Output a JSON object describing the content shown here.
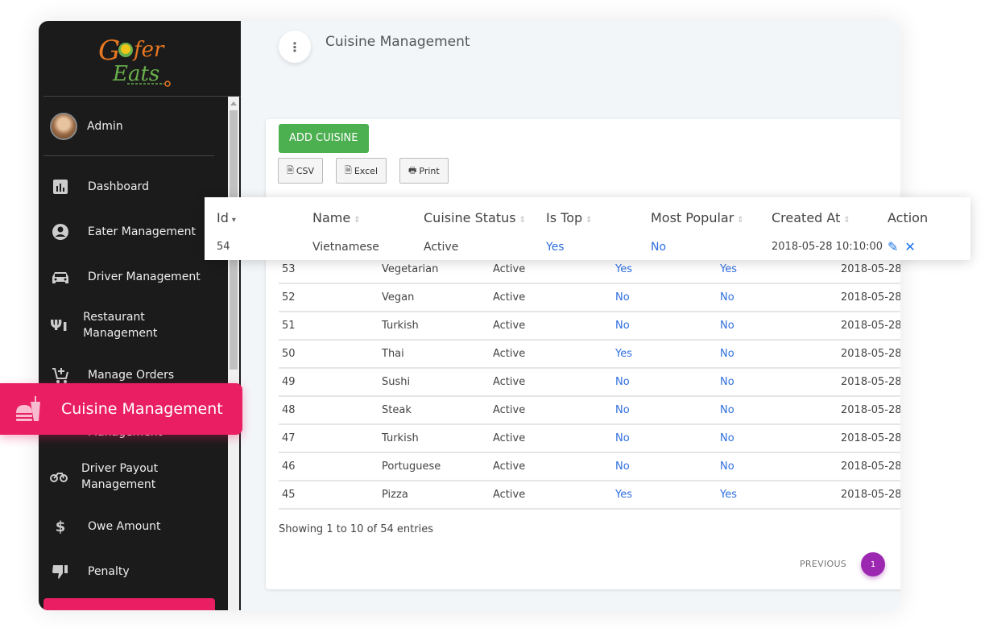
{
  "app": {
    "brand": "Gofer Eats"
  },
  "sidebar": {
    "user": {
      "name": "Admin"
    },
    "items": [
      {
        "label": "Dashboard",
        "icon": "bar-chart-icon"
      },
      {
        "label": "Eater Management",
        "icon": "account-circle-icon"
      },
      {
        "label": "Driver Management",
        "icon": "car-icon"
      },
      {
        "label": "Restaurant Management",
        "icon": "restaurant-icon"
      },
      {
        "label": "Manage Orders",
        "icon": "cart-plus-icon"
      },
      {
        "label": "Management",
        "icon": "payout-icon"
      },
      {
        "label": "Driver Payout Management",
        "icon": "motorcycle-icon"
      },
      {
        "label": "Owe Amount",
        "icon": "dollar-icon"
      },
      {
        "label": "Penalty",
        "icon": "thumbs-down-icon"
      }
    ],
    "active_item": {
      "label": "Cuisine Management",
      "icon": "fastfood-icon"
    }
  },
  "header": {
    "title": "Cuisine Management",
    "menu_icon": "more-vert-icon"
  },
  "toolbar": {
    "add_label": "ADD CUISINE",
    "csv_label": "CSV",
    "excel_label": "Excel",
    "print_label": "Print"
  },
  "table": {
    "columns": [
      "Id",
      "Name",
      "Cuisine Status",
      "Is Top",
      "Most Popular",
      "Created At",
      "Action"
    ],
    "highlight_row": {
      "id": "54",
      "name": "Vietnamese",
      "status": "Active",
      "is_top": "Yes",
      "most_popular": "No",
      "created_at": "2018-05-28 10:10:00"
    },
    "rows": [
      {
        "id": "53",
        "name": "Vegetarian",
        "status": "Active",
        "is_top": "Yes",
        "most_popular": "Yes",
        "created_at": "2018-05-28"
      },
      {
        "id": "52",
        "name": "Vegan",
        "status": "Active",
        "is_top": "No",
        "most_popular": "No",
        "created_at": "2018-05-28"
      },
      {
        "id": "51",
        "name": "Turkish",
        "status": "Active",
        "is_top": "No",
        "most_popular": "No",
        "created_at": "2018-05-28"
      },
      {
        "id": "50",
        "name": "Thai",
        "status": "Active",
        "is_top": "Yes",
        "most_popular": "No",
        "created_at": "2018-05-28"
      },
      {
        "id": "49",
        "name": "Sushi",
        "status": "Active",
        "is_top": "No",
        "most_popular": "No",
        "created_at": "2018-05-28"
      },
      {
        "id": "48",
        "name": "Steak",
        "status": "Active",
        "is_top": "No",
        "most_popular": "No",
        "created_at": "2018-05-28"
      },
      {
        "id": "47",
        "name": "Turkish",
        "status": "Active",
        "is_top": "No",
        "most_popular": "No",
        "created_at": "2018-05-28"
      },
      {
        "id": "46",
        "name": "Portuguese",
        "status": "Active",
        "is_top": "No",
        "most_popular": "No",
        "created_at": "2018-05-28"
      },
      {
        "id": "45",
        "name": "Pizza",
        "status": "Active",
        "is_top": "Yes",
        "most_popular": "Yes",
        "created_at": "2018-05-28"
      }
    ],
    "showing": "Showing 1 to 10 of 54 entries",
    "pagination": {
      "previous": "PREVIOUS",
      "current_page": "1"
    }
  },
  "colors": {
    "accent_pink": "#e91e63",
    "add_green": "#4caf50",
    "page_purple": "#9c27b0",
    "link_blue": "#2f6fde"
  }
}
